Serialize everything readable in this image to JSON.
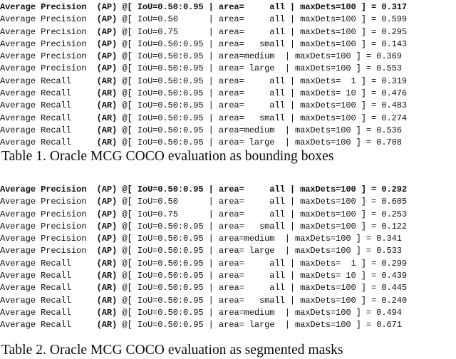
{
  "document": {
    "type": "paper-excerpt",
    "background_color": "#ffffff",
    "text_color": "#101010"
  },
  "tables": [
    {
      "id": "table-1",
      "caption": "Table 1. Oracle MCG COCO evaluation as bounding boxes",
      "caption_number": "Table 1.",
      "caption_text": "Oracle MCG COCO evaluation as bounding boxes",
      "rows": [
        {
          "metric_name": "Average Precision",
          "metric_tag": "(AP)",
          "iou": "IoU=0.50:0.95",
          "area": "area=     all",
          "max_dets": "maxDets=100",
          "value": "0.317",
          "bold": true,
          "line": "Average Precision  (AP) @[ IoU=0.50:0.95 | area=     all | maxDets=100 ] = 0.317"
        },
        {
          "metric_name": "Average Precision",
          "metric_tag": "(AP)",
          "iou": "IoU=0.50     ",
          "area": "area=     all",
          "max_dets": "maxDets=100",
          "value": "0.599",
          "bold": false,
          "line": "Average Precision  (AP) @[ IoU=0.50      | area=     all | maxDets=100 ] = 0.599"
        },
        {
          "metric_name": "Average Precision",
          "metric_tag": "(AP)",
          "iou": "IoU=0.75     ",
          "area": "area=     all",
          "max_dets": "maxDets=100",
          "value": "0.295",
          "bold": false,
          "line": "Average Precision  (AP) @[ IoU=0.75      | area=     all | maxDets=100 ] = 0.295"
        },
        {
          "metric_name": "Average Precision",
          "metric_tag": "(AP)",
          "iou": "IoU=0.50:0.95",
          "area": "area=   small",
          "max_dets": "maxDets=100",
          "value": "0.143",
          "bold": false,
          "line": "Average Precision  (AP) @[ IoU=0.50:0.95 | area=   small | maxDets=100 ] = 0.143"
        },
        {
          "metric_name": "Average Precision",
          "metric_tag": "(AP)",
          "iou": "IoU=0.50:0.95",
          "area": "area=  medium",
          "max_dets": "maxDets=100",
          "value": "0.369",
          "bold": false,
          "line": "Average Precision  (AP) @[ IoU=0.50:0.95 | area=medium  | maxDets=100 ] = 0.369"
        },
        {
          "metric_name": "Average Precision",
          "metric_tag": "(AP)",
          "iou": "IoU=0.50:0.95",
          "area": "area=   large",
          "max_dets": "maxDets=100",
          "value": "0.553",
          "bold": false,
          "line": "Average Precision  (AP) @[ IoU=0.50:0.95 | area= large  | maxDets=100 ] = 0.553"
        },
        {
          "metric_name": "Average Recall",
          "metric_tag": "(AR)",
          "iou": "IoU=0.50:0.95",
          "area": "area=     all",
          "max_dets": "maxDets=  1",
          "value": "0.319",
          "bold": false,
          "line": "Average Recall     (AR) @[ IoU=0.50:0.95 | area=     all | maxDets=  1 ] = 0.319"
        },
        {
          "metric_name": "Average Recall",
          "metric_tag": "(AR)",
          "iou": "IoU=0.50:0.95",
          "area": "area=     all",
          "max_dets": "maxDets= 10",
          "value": "0.476",
          "bold": false,
          "line": "Average Recall     (AR) @[ IoU=0.50:0.95 | area=     all | maxDets= 10 ] = 0.476"
        },
        {
          "metric_name": "Average Recall",
          "metric_tag": "(AR)",
          "iou": "IoU=0.50:0.95",
          "area": "area=     all",
          "max_dets": "maxDets=100",
          "value": "0.483",
          "bold": false,
          "line": "Average Recall     (AR) @[ IoU=0.50:0.95 | area=     all | maxDets=100 ] = 0.483"
        },
        {
          "metric_name": "Average Recall",
          "metric_tag": "(AR)",
          "iou": "IoU=0.50:0.95",
          "area": "area=   small",
          "max_dets": "maxDets=100",
          "value": "0.274",
          "bold": false,
          "line": "Average Recall     (AR) @[ IoU=0.50:0.95 | area=   small | maxDets=100 ] = 0.274"
        },
        {
          "metric_name": "Average Recall",
          "metric_tag": "(AR)",
          "iou": "IoU=0.50:0.95",
          "area": "area=  medium",
          "max_dets": "maxDets=100",
          "value": "0.536",
          "bold": false,
          "line": "Average Recall     (AR) @[ IoU=0.50:0.95 | area=medium  | maxDets=100 ] = 0.536"
        },
        {
          "metric_name": "Average Recall",
          "metric_tag": "(AR)",
          "iou": "IoU=0.50:0.95",
          "area": "area=   large",
          "max_dets": "maxDets=100",
          "value": "0.708",
          "bold": false,
          "line": "Average Recall     (AR) @[ IoU=0.50:0.95 | area= large  | maxDets=100 ] = 0.708"
        }
      ]
    },
    {
      "id": "table-2",
      "caption": "Table 2. Oracle MCG COCO evaluation as segmented masks",
      "caption_number": "Table 2.",
      "caption_text": "Oracle MCG COCO evaluation as segmented masks",
      "rows": [
        {
          "metric_name": "Average Precision",
          "metric_tag": "(AP)",
          "iou": "IoU=0.50:0.95",
          "area": "area=     all",
          "max_dets": "maxDets=100",
          "value": "0.292",
          "bold": true,
          "line": "Average Precision  (AP) @[ IoU=0.50:0.95 | area=     all | maxDets=100 ] = 0.292"
        },
        {
          "metric_name": "Average Precision",
          "metric_tag": "(AP)",
          "iou": "IoU=0.50     ",
          "area": "area=     all",
          "max_dets": "maxDets=100",
          "value": "0.605",
          "bold": false,
          "line": "Average Precision  (AP) @[ IoU=0.50      | area=     all | maxDets=100 ] = 0.605"
        },
        {
          "metric_name": "Average Precision",
          "metric_tag": "(AP)",
          "iou": "IoU=0.75     ",
          "area": "area=     all",
          "max_dets": "maxDets=100",
          "value": "0.253",
          "bold": false,
          "line": "Average Precision  (AP) @[ IoU=0.75      | area=     all | maxDets=100 ] = 0.253"
        },
        {
          "metric_name": "Average Precision",
          "metric_tag": "(AP)",
          "iou": "IoU=0.50:0.95",
          "area": "area=   small",
          "max_dets": "maxDets=100",
          "value": "0.122",
          "bold": false,
          "line": "Average Precision  (AP) @[ IoU=0.50:0.95 | area=   small | maxDets=100 ] = 0.122"
        },
        {
          "metric_name": "Average Precision",
          "metric_tag": "(AP)",
          "iou": "IoU=0.50:0.95",
          "area": "area=  medium",
          "max_dets": "maxDets=100",
          "value": "0.341",
          "bold": false,
          "line": "Average Precision  (AP) @[ IoU=0.50:0.95 | area=medium  | maxDets=100 ] = 0.341"
        },
        {
          "metric_name": "Average Precision",
          "metric_tag": "(AP)",
          "iou": "IoU=0.50:0.95",
          "area": "area=   large",
          "max_dets": "maxDets=100",
          "value": "0.533",
          "bold": false,
          "line": "Average Precision  (AP) @[ IoU=0.50:0.95 | area= large  | maxDets=100 ] = 0.533"
        },
        {
          "metric_name": "Average Recall",
          "metric_tag": "(AR)",
          "iou": "IoU=0.50:0.95",
          "area": "area=     all",
          "max_dets": "maxDets=  1",
          "value": "0.299",
          "bold": false,
          "line": "Average Recall     (AR) @[ IoU=0.50:0.95 | area=     all | maxDets=  1 ] = 0.299"
        },
        {
          "metric_name": "Average Recall",
          "metric_tag": "(AR)",
          "iou": "IoU=0.50:0.95",
          "area": "area=     all",
          "max_dets": "maxDets= 10",
          "value": "0.439",
          "bold": false,
          "line": "Average Recall     (AR) @[ IoU=0.50:0.95 | area=     all | maxDets= 10 ] = 0.439"
        },
        {
          "metric_name": "Average Recall",
          "metric_tag": "(AR)",
          "iou": "IoU=0.50:0.95",
          "area": "area=     all",
          "max_dets": "maxDets=100",
          "value": "0.445",
          "bold": false,
          "line": "Average Recall     (AR) @[ IoU=0.50:0.95 | area=     all | maxDets=100 ] = 0.445"
        },
        {
          "metric_name": "Average Recall",
          "metric_tag": "(AR)",
          "iou": "IoU=0.50:0.95",
          "area": "area=   small",
          "max_dets": "maxDets=100",
          "value": "0.240",
          "bold": false,
          "line": "Average Recall     (AR) @[ IoU=0.50:0.95 | area=   small | maxDets=100 ] = 0.240"
        },
        {
          "metric_name": "Average Recall",
          "metric_tag": "(AR)",
          "iou": "IoU=0.50:0.95",
          "area": "area=  medium",
          "max_dets": "maxDets=100",
          "value": "0.494",
          "bold": false,
          "line": "Average Recall     (AR) @[ IoU=0.50:0.95 | area=medium  | maxDets=100 ] = 0.494"
        },
        {
          "metric_name": "Average Recall",
          "metric_tag": "(AR)",
          "iou": "IoU=0.50:0.95",
          "area": "area=   large",
          "max_dets": "maxDets=100",
          "value": "0.671",
          "bold": false,
          "line": "Average Recall     (AR) @[ IoU=0.50:0.95 | area= large  | maxDets=100 ] = 0.671"
        }
      ]
    }
  ]
}
